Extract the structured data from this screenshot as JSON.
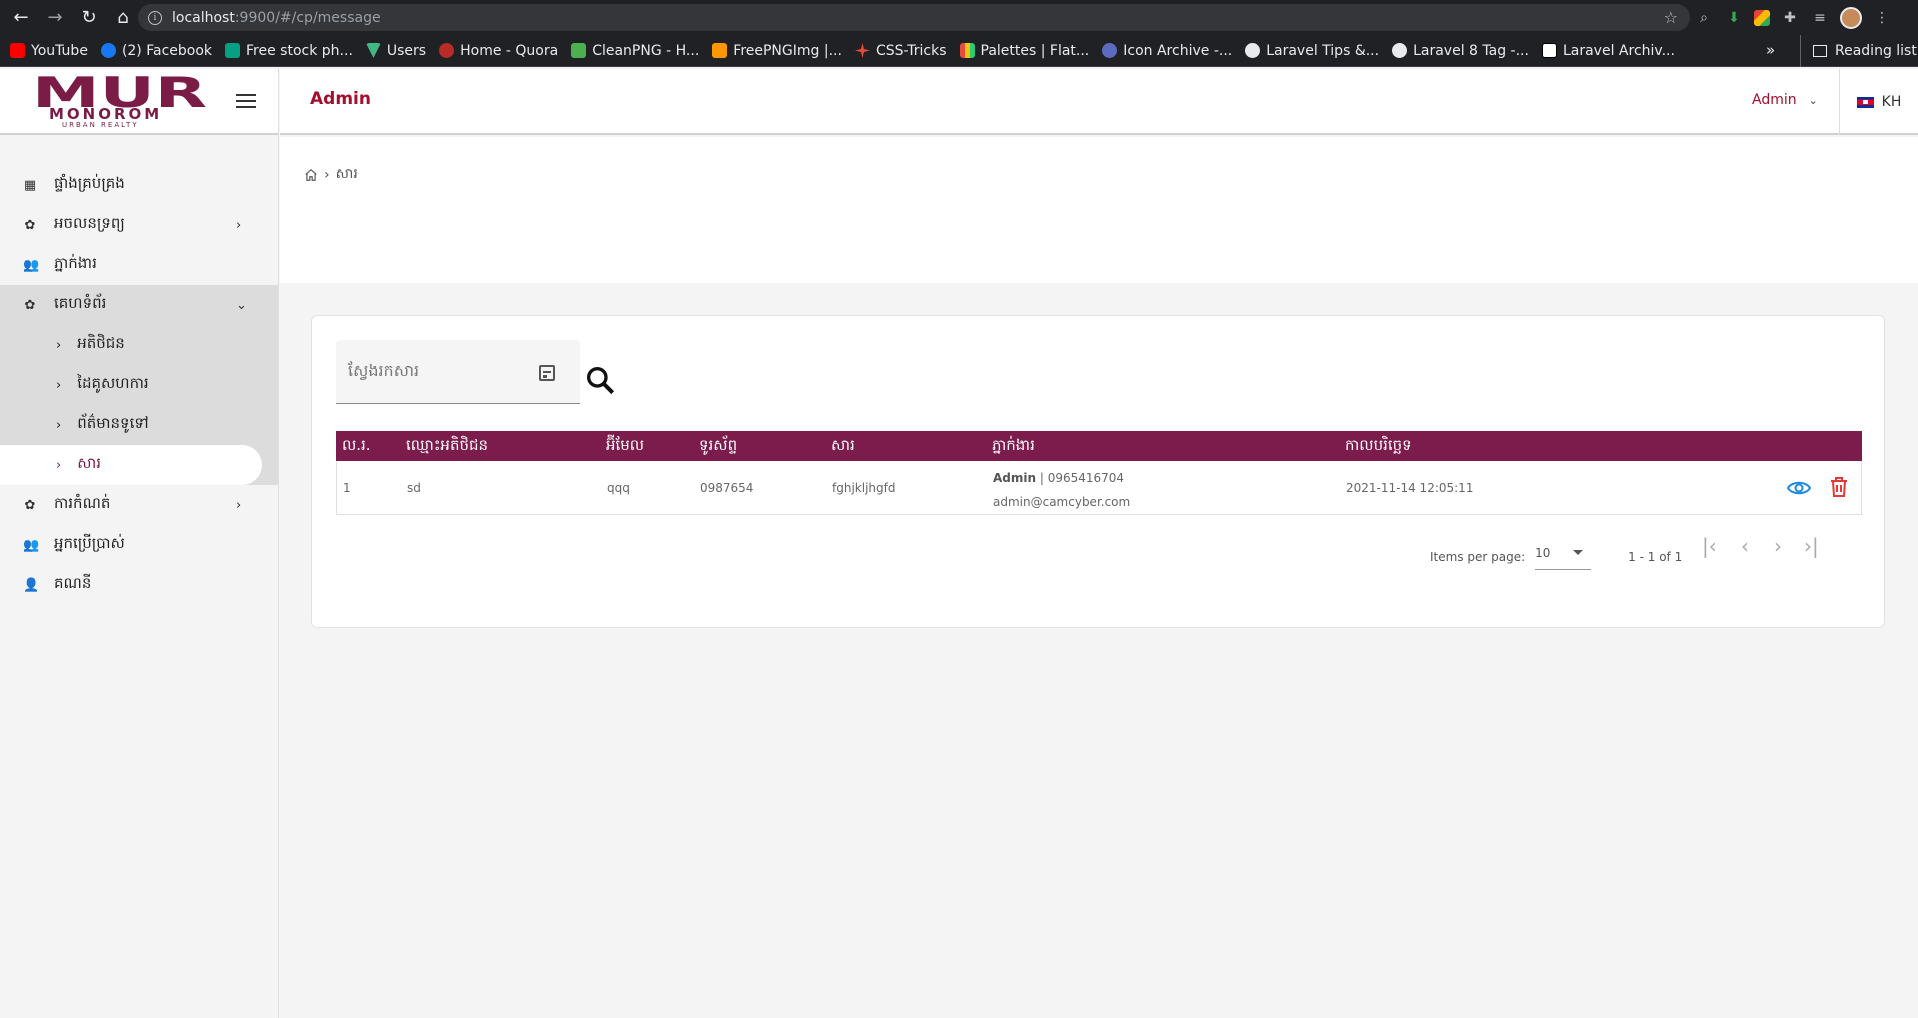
{
  "browser": {
    "url_host": "localhost",
    "url_path": ":9900/#/cp/message",
    "bookmarks": [
      {
        "label": "YouTube",
        "color": "#ff0000"
      },
      {
        "label": "(2) Facebook",
        "color": "#1877f2"
      },
      {
        "label": "Free stock ph...",
        "color": "#05a081"
      },
      {
        "label": "Users",
        "color": "#41b883"
      },
      {
        "label": "Home - Quora",
        "color": "#b92b27"
      },
      {
        "label": "CleanPNG - H...",
        "color": "#4caf50"
      },
      {
        "label": "FreePNGImg |...",
        "color": "#ff9800"
      },
      {
        "label": "CSS-Tricks",
        "color": "#e94b35"
      },
      {
        "label": "Palettes | Flat...",
        "color": "#9c27b0"
      },
      {
        "label": "Icon Archive -...",
        "color": "#5c6bc0"
      },
      {
        "label": "Laravel Tips &...",
        "color": "#e8eaed"
      },
      {
        "label": "Laravel 8 Tag -...",
        "color": "#e8eaed"
      },
      {
        "label": "Laravel Archiv...",
        "color": "#000000"
      }
    ],
    "more": "»",
    "reading_list": "Reading list"
  },
  "brand": {
    "name": "MUR",
    "sub": "MONOROM",
    "sub2": "URBAN REALTY",
    "color": "#7b1c47"
  },
  "sidebar": {
    "items": [
      {
        "label": "ផ្ទាំងគ្រប់គ្រង",
        "icon": "dashboard-icon"
      },
      {
        "label": "អចលនទ្រព្យ",
        "icon": "gear-icon",
        "chev": "›"
      },
      {
        "label": "ភ្នាក់ងារ",
        "icon": "people-icon"
      },
      {
        "label": "គេហទំព័រ",
        "icon": "gear-icon",
        "chev": "⌄"
      }
    ],
    "sub_items": [
      {
        "label": "អតិថិជន"
      },
      {
        "label": "ដៃគូសហការ"
      },
      {
        "label": "ព័ត៌មានទូទៅ"
      },
      {
        "label": "សារ"
      }
    ],
    "items_after": [
      {
        "label": "ការកំណត់",
        "icon": "gear-icon",
        "chev": "›"
      },
      {
        "label": "អ្នកប្រើប្រាស់",
        "icon": "people-icon"
      },
      {
        "label": "គណនី",
        "icon": "person-icon"
      }
    ]
  },
  "topbar": {
    "title": "Admin",
    "user": "Admin",
    "lang": "KH"
  },
  "breadcrumb": {
    "current": "សារ"
  },
  "search": {
    "placeholder": "ស្វែងរកសារ"
  },
  "table": {
    "headers": [
      "ល.រ.",
      "ឈ្មោះអតិថិជន",
      "អ៊ីមែល",
      "ទូរស័ព្ទ",
      "សារ",
      "ភ្នាក់ងារ",
      "កាលបរិច្ឆេទ"
    ],
    "rows": [
      {
        "no": "1",
        "name": "sd",
        "email": "qqq",
        "phone": "0987654",
        "message": "fghjkljhgfd",
        "agent_name": "Admin",
        "agent_phone": " | 0965416704",
        "agent_email": "admin@camcyber.com",
        "date": "2021-11-14 12:05:11"
      }
    ]
  },
  "pagination": {
    "items_per_page_label": "Items per page:",
    "items_per_page": "10",
    "range": "1 - 1 of 1"
  }
}
